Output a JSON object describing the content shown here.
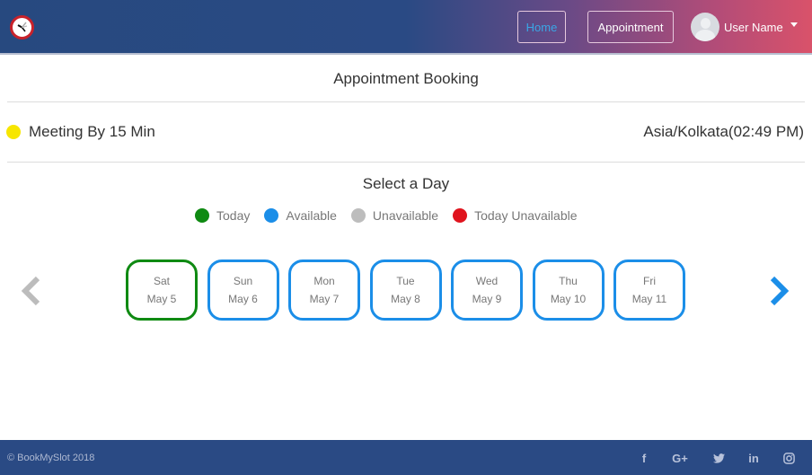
{
  "navbar": {
    "logo_icon": "clock-icon",
    "home_label": "Home",
    "appointment_label": "Appointment",
    "user_name": "User Name",
    "colors": {
      "start": "#27497f",
      "end": "#d9526a",
      "active_link": "#3aa6e6"
    }
  },
  "page": {
    "title": "Appointment Booking",
    "meeting_label": "Meeting By 15 Min",
    "meeting_color": "#f7e600",
    "timezone": "Asia/Kolkata(02:49 PM)",
    "select_day_label": "Select a Day"
  },
  "legend": [
    {
      "label": "Today",
      "color": "#0f8a12"
    },
    {
      "label": "Available",
      "color": "#1b8ee8"
    },
    {
      "label": "Unavailable",
      "color": "#bdbdbd"
    },
    {
      "label": "Today Unavailable",
      "color": "#e0141e"
    }
  ],
  "days": [
    {
      "day": "Sat",
      "date": "May 5",
      "status": "today"
    },
    {
      "day": "Sun",
      "date": "May 6",
      "status": "available"
    },
    {
      "day": "Mon",
      "date": "May 7",
      "status": "available"
    },
    {
      "day": "Tue",
      "date": "May 8",
      "status": "available"
    },
    {
      "day": "Wed",
      "date": "May 9",
      "status": "available"
    },
    {
      "day": "Thu",
      "date": "May 10",
      "status": "available"
    },
    {
      "day": "Fri",
      "date": "May 11",
      "status": "available"
    }
  ],
  "navigation": {
    "prev_icon": "chevron-left-icon",
    "next_icon": "chevron-right-icon"
  },
  "footer": {
    "copyright": "© BookMySlot 2018",
    "social": [
      {
        "name": "facebook-icon",
        "glyph": "f"
      },
      {
        "name": "google-plus-icon",
        "glyph": "G+"
      },
      {
        "name": "twitter-icon",
        "glyph": "🐦"
      },
      {
        "name": "linkedin-icon",
        "glyph": "in"
      },
      {
        "name": "instagram-icon",
        "glyph": "◎"
      }
    ]
  }
}
